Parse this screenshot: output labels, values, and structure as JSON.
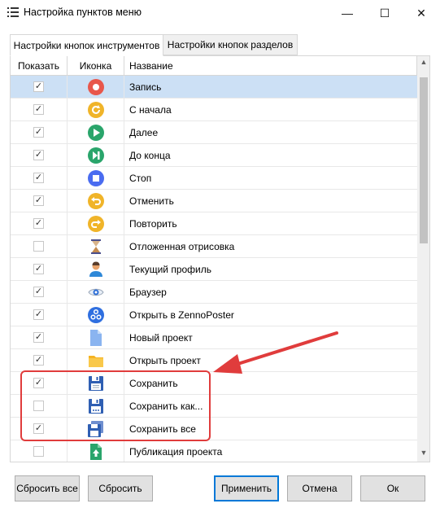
{
  "window": {
    "title": "Настройка пунктов меню",
    "min_glyph": "—",
    "max_glyph": "☐",
    "close_glyph": "✕"
  },
  "tabs": [
    {
      "label": "Настройки кнопок инструментов",
      "active": true
    },
    {
      "label": "Настройки кнопок разделов",
      "active": false
    }
  ],
  "table": {
    "headers": {
      "show": "Показать",
      "icon": "Иконка",
      "name": "Название"
    },
    "rows": [
      {
        "checked": true,
        "icon": "record-icon",
        "name": "Запись",
        "selected": true
      },
      {
        "checked": true,
        "icon": "restart-icon",
        "name": "С начала",
        "selected": false
      },
      {
        "checked": true,
        "icon": "play-icon",
        "name": "Далее",
        "selected": false
      },
      {
        "checked": true,
        "icon": "skip-to-end-icon",
        "name": "До конца",
        "selected": false
      },
      {
        "checked": true,
        "icon": "stop-icon",
        "name": "Стоп",
        "selected": false
      },
      {
        "checked": true,
        "icon": "undo-icon",
        "name": "Отменить",
        "selected": false
      },
      {
        "checked": true,
        "icon": "redo-icon",
        "name": "Повторить",
        "selected": false
      },
      {
        "checked": false,
        "icon": "hourglass-icon",
        "name": "Отложенная отрисовка",
        "selected": false
      },
      {
        "checked": true,
        "icon": "user-profile-icon",
        "name": "Текущий профиль",
        "selected": false
      },
      {
        "checked": true,
        "icon": "eye-icon",
        "name": "Браузер",
        "selected": false
      },
      {
        "checked": true,
        "icon": "zennoposter-icon",
        "name": "Открыть в ZennoPoster",
        "selected": false
      },
      {
        "checked": true,
        "icon": "new-file-icon",
        "name": "Новый проект",
        "selected": false
      },
      {
        "checked": true,
        "icon": "folder-icon",
        "name": "Открыть проект",
        "selected": false
      },
      {
        "checked": true,
        "icon": "save-icon",
        "name": "Сохранить",
        "selected": false
      },
      {
        "checked": false,
        "icon": "save-as-icon",
        "name": "Сохранить как...",
        "selected": false
      },
      {
        "checked": true,
        "icon": "save-all-icon",
        "name": "Сохранить все",
        "selected": false
      },
      {
        "checked": false,
        "icon": "publish-project-icon",
        "name": "Публикация проекта",
        "selected": false
      }
    ]
  },
  "checkmark_glyph": "✓",
  "scroll": {
    "up_glyph": "▲",
    "down_glyph": "▼"
  },
  "buttons": {
    "reset_all": "Сбросить все",
    "reset": "Сбросить",
    "apply": "Применить",
    "cancel": "Отмена",
    "ok": "Ок"
  },
  "annotation": {
    "color": "#e03c3c"
  },
  "colors": {
    "selection": "#cce0f5",
    "accent": "#0078d7"
  }
}
